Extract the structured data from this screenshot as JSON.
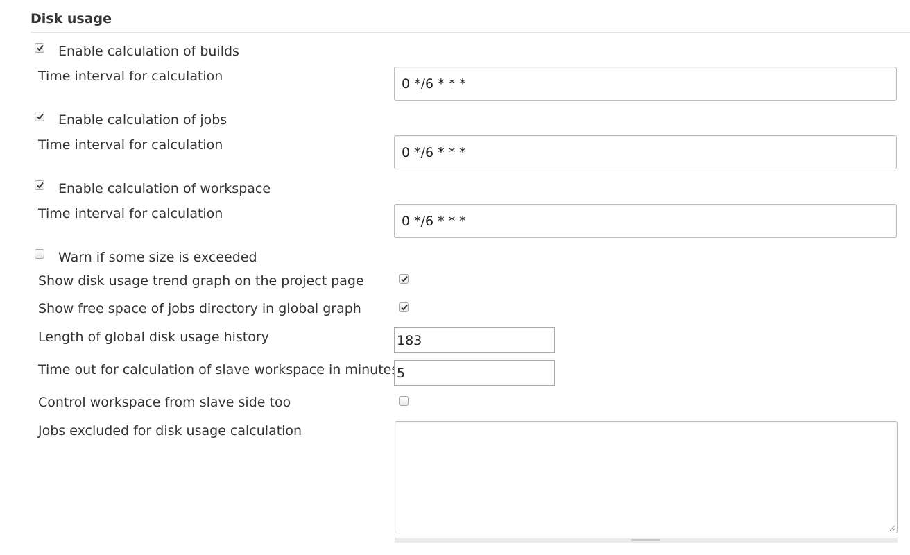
{
  "section": {
    "title": "Disk usage"
  },
  "builds": {
    "enable_label": "Enable calculation of builds",
    "enabled": true,
    "interval_label": "Time interval for calculation",
    "interval_value": "0 */6 * * *"
  },
  "jobs": {
    "enable_label": "Enable calculation of jobs",
    "enabled": true,
    "interval_label": "Time interval for calculation",
    "interval_value": "0 */6 * * *"
  },
  "workspace": {
    "enable_label": "Enable calculation of workspace",
    "enabled": true,
    "interval_label": "Time interval for calculation",
    "interval_value": "0 */6 * * *"
  },
  "warn": {
    "label": "Warn if some size is exceeded",
    "checked": false
  },
  "trend_graph": {
    "label": "Show disk usage trend graph on the project page",
    "checked": true
  },
  "free_space": {
    "label": "Show free space of jobs directory in global graph",
    "checked": true
  },
  "history_length": {
    "label": "Length of global disk usage history",
    "value": "183"
  },
  "timeout": {
    "label": "Time out for calculation of slave workspace in minutes",
    "value": "5"
  },
  "control_workspace": {
    "label": "Control workspace from slave side too",
    "checked": false
  },
  "excluded_jobs": {
    "label": "Jobs excluded for disk usage calculation",
    "value": ""
  }
}
